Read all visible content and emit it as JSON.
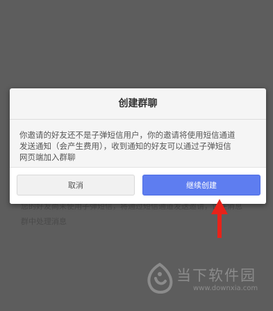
{
  "background": {
    "lines": [
      "您的好友尚未使用子弹短信，将通过短信通道发送邀请，请在消息",
      "群中处理消息"
    ]
  },
  "dialog": {
    "title": "创建群聊",
    "message_lines": [
      "你邀请的好友还不是子弹短信用户，你的邀请将使用短信通道",
      "发送通知（会产生费用），收到通知的好友可以通过子弹短信",
      "网页端加入群聊"
    ],
    "cancel_label": "取消",
    "confirm_label": "继续创建"
  },
  "colors": {
    "confirm": "#5e7df0",
    "arrow": "#e8231a",
    "overlay": "#5d5d5d"
  },
  "watermark": {
    "name": "当下软件园",
    "url": "www.downxia.com"
  }
}
